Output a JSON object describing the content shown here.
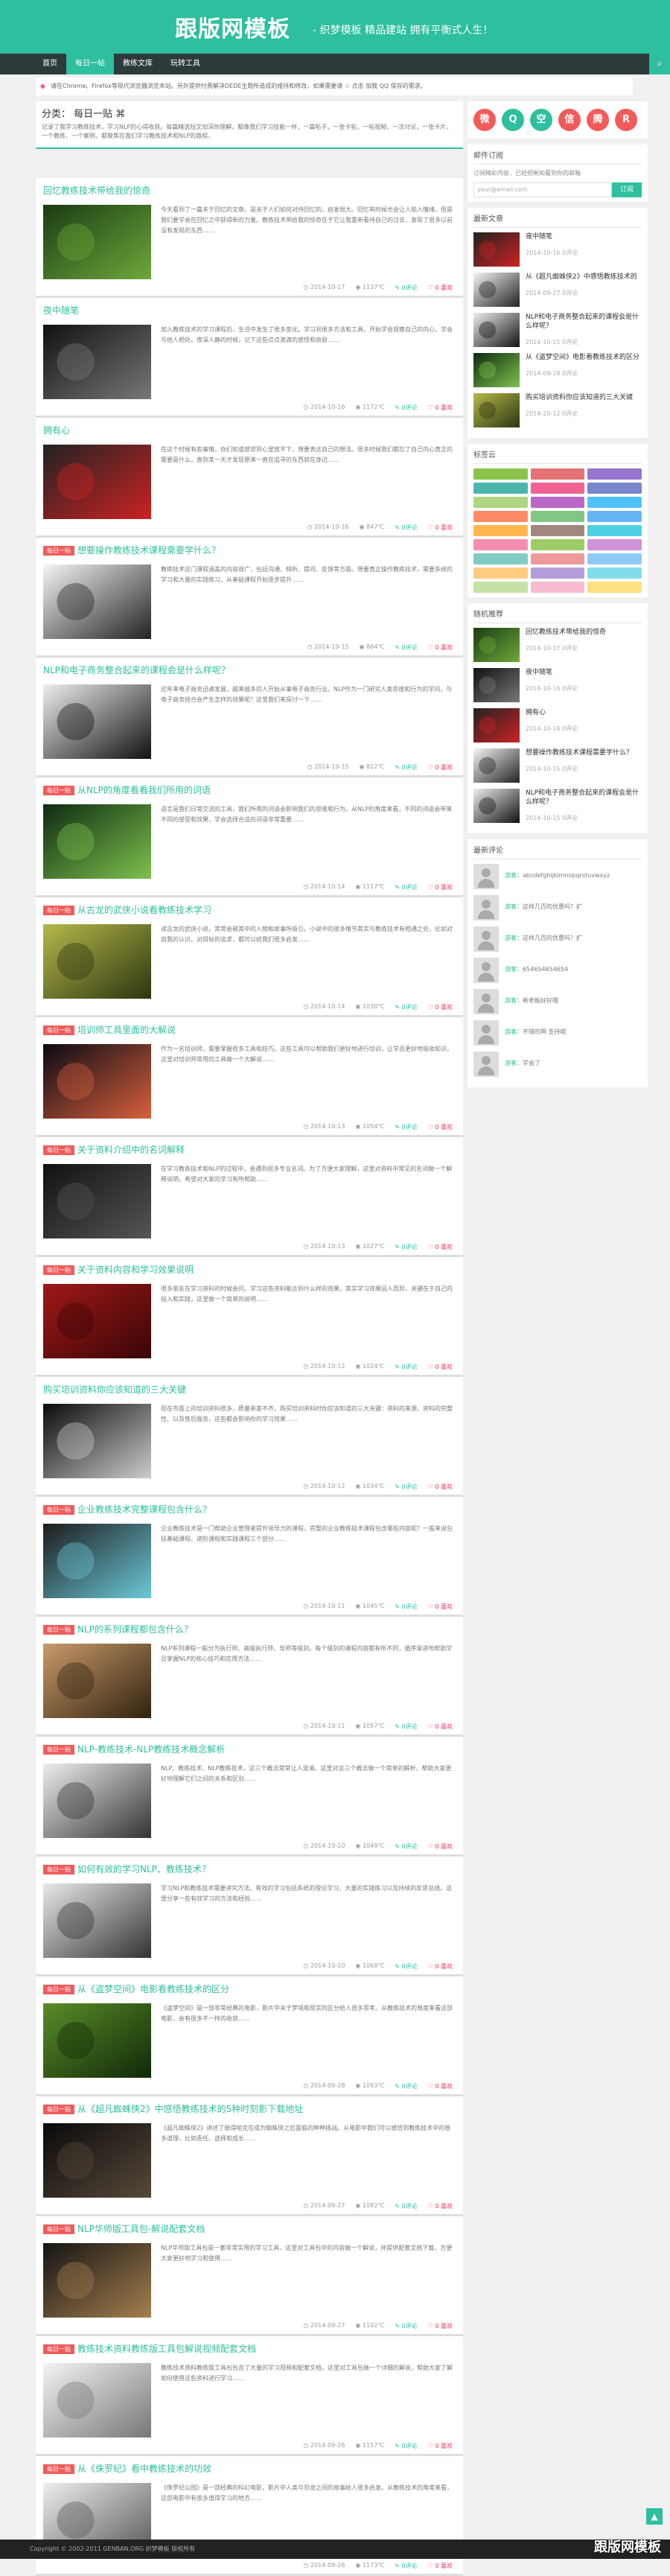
{
  "header": {
    "logo": "跟版网模板",
    "slogan": "- 织梦模板 精品建站 拥有平衡式人生！"
  },
  "nav": {
    "items": [
      "首页",
      "每日一帖",
      "教练文库",
      "玩转工具"
    ],
    "search_icon": "⌕"
  },
  "notice": {
    "bell": "◉",
    "text": "请在Chrome、Firefox等现代浏览器浏览本站。另外提供付费解决DEDE主题所造成的维持和修改，如果需要请 ☆ 点击 加我 QQ 保存的需求。"
  },
  "category": {
    "title": "分类： 每日一贴 ⌘",
    "desc": "记录了我学习教练技术，学习NLP的心得收获。每篇精选短文加深你理解，都像我们学习技能一样，一篇帖子，一张卡帖，一帖视频，一次讨论，一张卡片，一个教练，一个案例，都聚焦在我们学习教练技术和NLP的路程。"
  },
  "posts": [
    {
      "badge": "",
      "title": "回忆教练技术带给我的惊奇",
      "excerpt": "今天看到了一篇关于回忆的文章，是关于人们如何对待回忆的，启发很大。回忆有时候也会让人陷入情绪，但是我们要学会在回忆之中获得新的力量。教练技术带给我的惊奇在于它让我重新看待自己的过去，发现了很多以前没有发现的东西……",
      "date": "2014-10-17",
      "views": "1137℃",
      "comments": "0评论",
      "likes": "0 喜欢"
    },
    {
      "badge": "",
      "title": "夜中随笔",
      "excerpt": "加入教练技术的学习课程后，生活中发生了很多变化。学习到很多方法和工具，开始学会观察自己的内心，学会与他人相处。夜深人静的时候，记下这些点点滴滴的感悟和收获……",
      "date": "2014-10-16",
      "views": "1172℃",
      "comments": "0评论",
      "likes": "0 喜欢"
    },
    {
      "badge": "",
      "title": "拥有心",
      "excerpt": "在这个时候有些事情，你们知道感觉到心里放不下，想要表达自己的想法。很多时候我们都忘了自己内心真正的需要是什么，直到某一天才发现原来一直在追寻的东西就在身边……",
      "date": "2014-10-16",
      "views": "847℃",
      "comments": "0评论",
      "likes": "0 喜欢"
    },
    {
      "badge": "每日一贴",
      "title": "想要操作教练技术课程需要学什么？",
      "excerpt": "教练技术这门课程涵盖的内容很广，包括沟通、倾听、提问、反馈等方面。想要真正操作教练技术，需要系统的学习和大量的实践练习，从基础课程开始逐步提升……",
      "date": "2014-10-15",
      "views": "864℃",
      "comments": "0评论",
      "likes": "0 喜欢"
    },
    {
      "badge": "",
      "title": "NLP和电子商务整合起来的课程会是什么样呢？",
      "excerpt": "近年来电子商务迅速发展，越来越多的人开始从事电子商务行业。NLP作为一门研究人类思维和行为的学问，与电子商务结合会产生怎样的效果呢？这里我们来探讨一下……",
      "date": "2014-10-15",
      "views": "822℃",
      "comments": "0评论",
      "likes": "0 喜欢"
    },
    {
      "badge": "每日一贴",
      "title": "从NLP的角度看看我们所用的词语",
      "excerpt": "语言是我们日常交流的工具，我们所用的词语会影响我们的思维和行为。从NLP的角度来看，不同的词语会带来不同的感受和效果，学会选择合适的词语非常重要……",
      "date": "2014-10-14",
      "views": "1117℃",
      "comments": "0评论",
      "likes": "0 喜欢"
    },
    {
      "badge": "每日一贴",
      "title": "从古龙的武侠小说看教练技术学习",
      "excerpt": "读古龙的武侠小说，常常会被其中的人物和故事所吸引。小说中的很多情节其实与教练技术有相通之处，比如对自我的认识、对目标的追求，都可以给我们很多启发……",
      "date": "2014-10-14",
      "views": "1030℃",
      "comments": "0评论",
      "likes": "0 喜欢"
    },
    {
      "badge": "每日一贴",
      "title": "培训师工具里面的大解说",
      "excerpt": "作为一名培训师，需要掌握很多工具和技巧。这些工具可以帮助我们更好地进行培训，让学员更好地吸收知识。这里对培训师常用的工具做一个大解说……",
      "date": "2014-10-13",
      "views": "1054℃",
      "comments": "0评论",
      "likes": "0 喜欢"
    },
    {
      "badge": "每日一贴",
      "title": "关于资料介绍中的名词解释",
      "excerpt": "在学习教练技术和NLP的过程中，会遇到很多专业名词。为了方便大家理解，这里对资料中常见的名词做一个解释说明，希望对大家的学习有所帮助……",
      "date": "2014-10-13",
      "views": "1027℃",
      "comments": "0评论",
      "likes": "0 喜欢"
    },
    {
      "badge": "每日一贴",
      "title": "关于资料内容和学习效果说明",
      "excerpt": "很多朋友在学习资料的时候会问，学习这些资料能达到什么样的效果。其实学习效果因人而异，关键在于自己的投入和实践，这里做一个简单的说明……",
      "date": "2014-10-12",
      "views": "1024℃",
      "comments": "0评论",
      "likes": "0 喜欢"
    },
    {
      "badge": "",
      "title": "购买培训资料你应该知道的三大关键",
      "excerpt": "现在市面上的培训资料很多，质量参差不齐。购买培训资料时你应该知道的三大关键：资料的来源、资料的完整性、以及售后服务，这些都会影响你的学习效果……",
      "date": "2014-10-12",
      "views": "1034℃",
      "comments": "0评论",
      "likes": "0 喜欢"
    },
    {
      "badge": "每日一贴",
      "title": "企业教练技术完整课程包含什么？",
      "excerpt": "企业教练技术是一门帮助企业管理者提升领导力的课程。完整的企业教练技术课程包含哪些内容呢？一般来说包括基础课程、进阶课程和实践课程三个部分……",
      "date": "2014-10-11",
      "views": "1045℃",
      "comments": "0评论",
      "likes": "0 喜欢"
    },
    {
      "badge": "每日一贴",
      "title": "NLP的系列课程都包含什么？",
      "excerpt": "NLP系列课程一般分为执行师、高级执行师、导师等级别。每个级别的课程内容都有所不同，循序渐进地帮助学员掌握NLP的核心技巧和应用方法……",
      "date": "2014-10-11",
      "views": "1057℃",
      "comments": "0评论",
      "likes": "0 喜欢"
    },
    {
      "badge": "每日一贴",
      "title": "NLP-教练技术-NLP教练技术概念解析",
      "excerpt": "NLP、教练技术、NLP教练技术，这三个概念常常让人混淆。这里对这三个概念做一个简单的解析，帮助大家更好地理解它们之间的关系和区别……",
      "date": "2014-10-10",
      "views": "1049℃",
      "comments": "0评论",
      "likes": "0 喜欢"
    },
    {
      "badge": "每日一贴",
      "title": "如何有效的学习NLP、教练技术？",
      "excerpt": "学习NLP和教练技术需要讲究方法。有效的学习包括系统的理论学习、大量的实践练习以及持续的反思总结。这里分享一些有效学习的方法和经验……",
      "date": "2014-10-10",
      "views": "1068℃",
      "comments": "0评论",
      "likes": "0 喜欢"
    },
    {
      "badge": "每日一贴",
      "title": "从《盗梦空间》电影看教练技术的区分",
      "excerpt": "《盗梦空间》是一部非常经典的电影，影片中关于梦境和现实的区分给人很多思考。从教练技术的角度来看这部电影，会有很多不一样的收获……",
      "date": "2014-09-28",
      "views": "1093℃",
      "comments": "0评论",
      "likes": "0 喜欢"
    },
    {
      "badge": "每日一贴",
      "title": "从《超凡蜘蛛侠2》中感悟教练技术的5种时刻影下载地址",
      "excerpt": "《超凡蜘蛛侠2》讲述了彼得帕克在成为蜘蛛侠之后面临的种种挑战。从电影中我们可以感悟到教练技术中的很多道理，比如责任、选择和成长……",
      "date": "2014-09-27",
      "views": "1082℃",
      "comments": "0评论",
      "likes": "0 喜欢"
    },
    {
      "badge": "每日一贴",
      "title": "NLP华师版工具包-解说配套文档",
      "excerpt": "NLP华师版工具包是一套非常实用的学习工具，这里对工具包中的内容做一个解说，并提供配套文档下载，方便大家更好地学习和使用……",
      "date": "2014-09-27",
      "views": "1102℃",
      "comments": "0评论",
      "likes": "0 喜欢"
    },
    {
      "badge": "每日一贴",
      "title": "教练技术资料教练版工具包解说视频配套文档",
      "excerpt": "教练技术资料教练版工具包包含了大量的学习视频和配套文档，这里对工具包做一个详细的解说，帮助大家了解如何使用这些资料进行学习……",
      "date": "2014-09-26",
      "views": "1157℃",
      "comments": "0评论",
      "likes": "0 喜欢"
    },
    {
      "badge": "每日一贴",
      "title": "从《侏罗纪》看中教练技术的功效",
      "excerpt": "《侏罗纪公园》是一部经典的科幻电影，影片中人类与恐龙之间的故事给人很多启发。从教练技术的角度来看，这部电影中有很多值得学习的地方……",
      "date": "2014-09-26",
      "views": "1173℃",
      "comments": "0评论",
      "likes": "0 喜欢"
    }
  ],
  "sidebar": {
    "socials": [
      {
        "name": "weibo",
        "glyph": "微",
        "color": "#f35b5b"
      },
      {
        "name": "qq",
        "glyph": "Q",
        "color": "#2dbf9e"
      },
      {
        "name": "qzone",
        "glyph": "空",
        "color": "#2dbf9e"
      },
      {
        "name": "wechat",
        "glyph": "信",
        "color": "#f35b5b"
      },
      {
        "name": "tencent",
        "glyph": "腾",
        "color": "#f35b5b"
      },
      {
        "name": "rss",
        "glyph": "R",
        "color": "#f35b5b"
      }
    ],
    "subscribe": {
      "title": "邮件订阅",
      "desc": "订阅精彩内容，已经把新知看到你的邮箱",
      "placeholder": "your@email.com",
      "button": "订阅"
    },
    "recent": {
      "title": "最新文章",
      "items": [
        {
          "title": "夜中随笔",
          "date": "2014-10-16",
          "comments": "0评论"
        },
        {
          "title": "从《超凡蜘蛛侠2》中感悟教练技术的",
          "date": "2014-09-27",
          "comments": "0评论"
        },
        {
          "title": "NLP和电子商务整合起来的课程会是什么样呢？",
          "date": "2014-10-15",
          "comments": "0评论"
        },
        {
          "title": "从《盗梦空间》电影看教练技术的区分",
          "date": "2014-09-28",
          "comments": "0评论"
        },
        {
          "title": "购买培训资料你应该知道的三大关键",
          "date": "2014-10-12",
          "comments": "0评论"
        }
      ]
    },
    "tags": {
      "title": "标签云",
      "colors": [
        "#8bc34a",
        "#e57373",
        "#9575cd",
        "#4db6ac",
        "#f06292",
        "#7986cb",
        "#aed581",
        "#ba68c8",
        "#4fc3f7",
        "#ff8a65",
        "#81c784",
        "#64b5f6",
        "#ffb74d",
        "#a1887f",
        "#4dd0e1",
        "#f48fb1",
        "#9ccc65",
        "#ce93d8",
        "#80cbc4",
        "#ef9a9a",
        "#90caf9",
        "#ffcc80",
        "#b39ddb",
        "#80deea",
        "#c5e1a5",
        "#f8bbd0",
        "#ffe082"
      ]
    },
    "popular": {
      "title": "随机推荐",
      "items": [
        {
          "title": "回忆教练技术带给我的惊奇",
          "date": "2014-10-17",
          "comments": "0评论"
        },
        {
          "title": "夜中随笔",
          "date": "2014-10-16",
          "comments": "0评论"
        },
        {
          "title": "拥有心",
          "date": "2014-10-16",
          "comments": "0评论"
        },
        {
          "title": "想要操作教练技术课程需要学什么？",
          "date": "2014-10-15",
          "comments": "0评论"
        },
        {
          "title": "NLP和电子商务整合起来的课程会是什么样呢？",
          "date": "2014-10-15",
          "comments": "0评论"
        }
      ]
    },
    "comments": {
      "title": "最新评论",
      "items": [
        {
          "user": "游客",
          "text": "abcdefghijklmnopqrstuvwxyz"
        },
        {
          "user": "游客",
          "text": "这样几百的优惠吗？扩"
        },
        {
          "user": "游客",
          "text": "这样几百的优惠吗？扩"
        },
        {
          "user": "游客",
          "text": "654654654654"
        },
        {
          "user": "游客",
          "text": "新老板好好哦"
        },
        {
          "user": "游客",
          "text": "不错的啊 支持呢"
        },
        {
          "user": "游客",
          "text": "学会了"
        }
      ]
    }
  },
  "footer": {
    "text": "Copyright © 2002-2011 GENBAN.ORG 织梦模板 版权所有",
    "watermark": "跟版网模板",
    "top_icon": "▲"
  }
}
